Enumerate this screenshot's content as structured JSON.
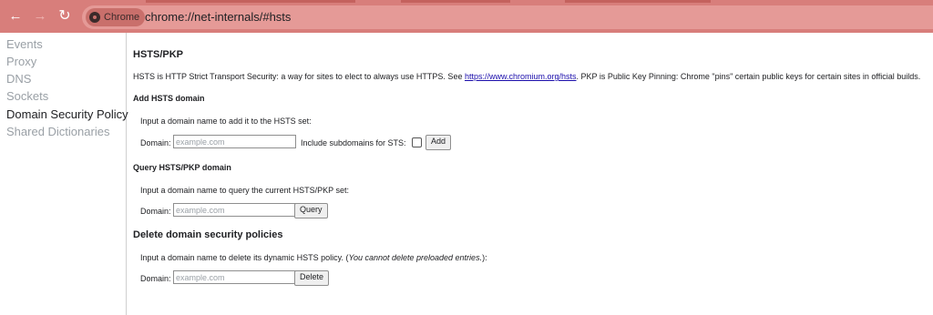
{
  "browser": {
    "chip_label": "Chrome",
    "url": "chrome://net-internals/#hsts",
    "back_icon": "←",
    "forward_icon": "→",
    "reload_icon": "↻"
  },
  "sidebar": {
    "items": [
      {
        "label": "Events"
      },
      {
        "label": "Proxy"
      },
      {
        "label": "DNS"
      },
      {
        "label": "Sockets"
      },
      {
        "label": "Domain Security Policy"
      },
      {
        "label": "Shared Dictionaries"
      }
    ],
    "active": "Domain Security Policy"
  },
  "main": {
    "title": "HSTS/PKP",
    "intro_before": "HSTS is HTTP Strict Transport Security: a way for sites to elect to always use HTTPS. See ",
    "intro_link": "https://www.chromium.org/hsts",
    "intro_after": ". PKP is Public Key Pinning: Chrome \"pins\" certain public keys for certain sites in official builds.",
    "add": {
      "heading": "Add HSTS domain",
      "desc": "Input a domain name to add it to the HSTS set:",
      "domain_label": "Domain:",
      "placeholder": "example.com",
      "subdomains_label": "Include subdomains for STS:",
      "button": "Add"
    },
    "query": {
      "heading": "Query HSTS/PKP domain",
      "desc": "Input a domain name to query the current HSTS/PKP set:",
      "domain_label": "Domain:",
      "placeholder": "example.com",
      "button": "Query"
    },
    "delete": {
      "heading": "Delete domain security policies",
      "desc_before": "Input a domain name to delete its dynamic HSTS policy. (",
      "desc_italic": "You cannot delete preloaded entries.",
      "desc_after": "):",
      "domain_label": "Domain:",
      "placeholder": "example.com",
      "button": "Delete"
    }
  }
}
